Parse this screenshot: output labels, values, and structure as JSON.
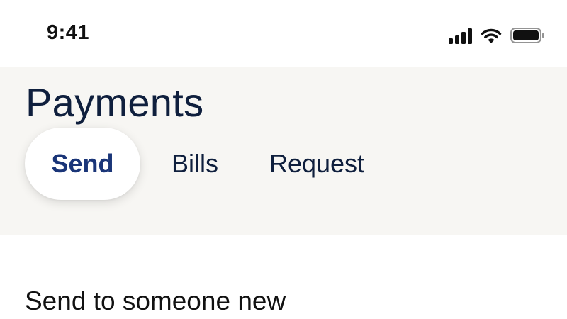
{
  "status_bar": {
    "time": "9:41",
    "icons": [
      "cellular-signal-icon",
      "wifi-icon",
      "battery-icon"
    ]
  },
  "header": {
    "title": "Payments"
  },
  "tabs": [
    {
      "label": "Send",
      "selected": true
    },
    {
      "label": "Bills",
      "selected": false
    },
    {
      "label": "Request",
      "selected": false
    }
  ],
  "content": {
    "section_heading": "Send to someone new"
  },
  "colors": {
    "header_background": "#f7f6f3",
    "title_text": "#0f1f3d",
    "selected_tab_text": "#1a3578",
    "selected_tab_background": "#ffffff"
  }
}
